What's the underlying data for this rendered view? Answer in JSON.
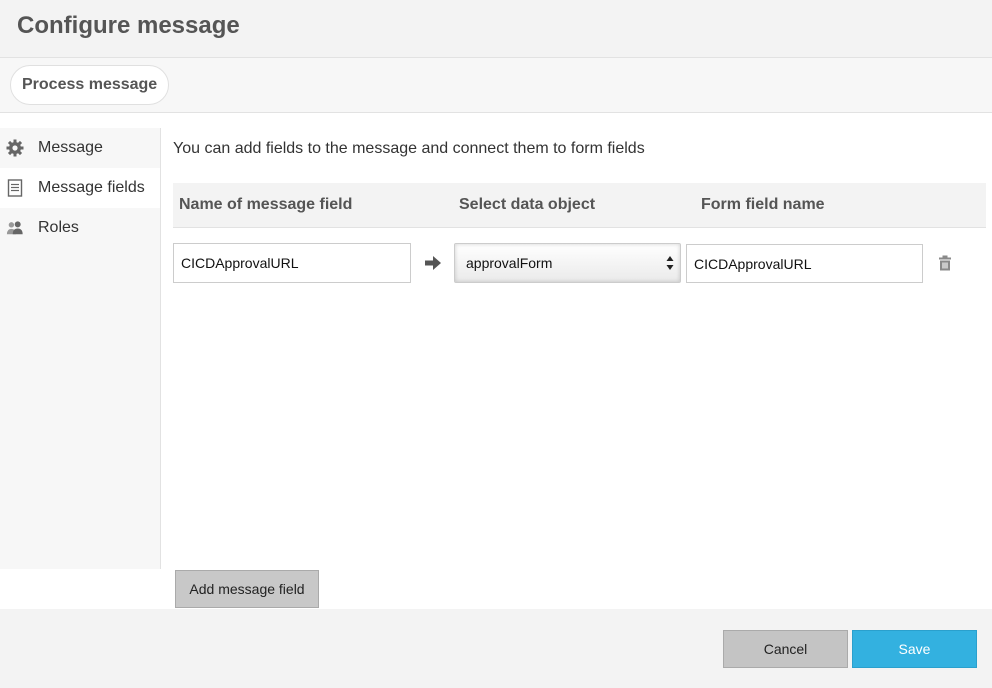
{
  "dialog": {
    "title": "Configure message"
  },
  "tabs": {
    "active_label": "Process message"
  },
  "sidebar": {
    "items": [
      {
        "label": "Message",
        "icon": "gear-icon"
      },
      {
        "label": "Message fields",
        "icon": "document-icon",
        "active": true
      },
      {
        "label": "Roles",
        "icon": "users-icon"
      }
    ]
  },
  "main": {
    "intro": "You can add fields to the message and connect them to form fields",
    "columns": [
      "Name of message field",
      "Select data object",
      "Form field name"
    ],
    "rows": [
      {
        "message_field": "CICDApprovalURL",
        "data_object": "approvalForm",
        "form_field": "CICDApprovalURL"
      }
    ],
    "add_button_label": "Add message field"
  },
  "footer": {
    "cancel_label": "Cancel",
    "save_label": "Save"
  },
  "colors": {
    "accent": "#33b1e0",
    "header_bg": "#f3f3f3"
  }
}
